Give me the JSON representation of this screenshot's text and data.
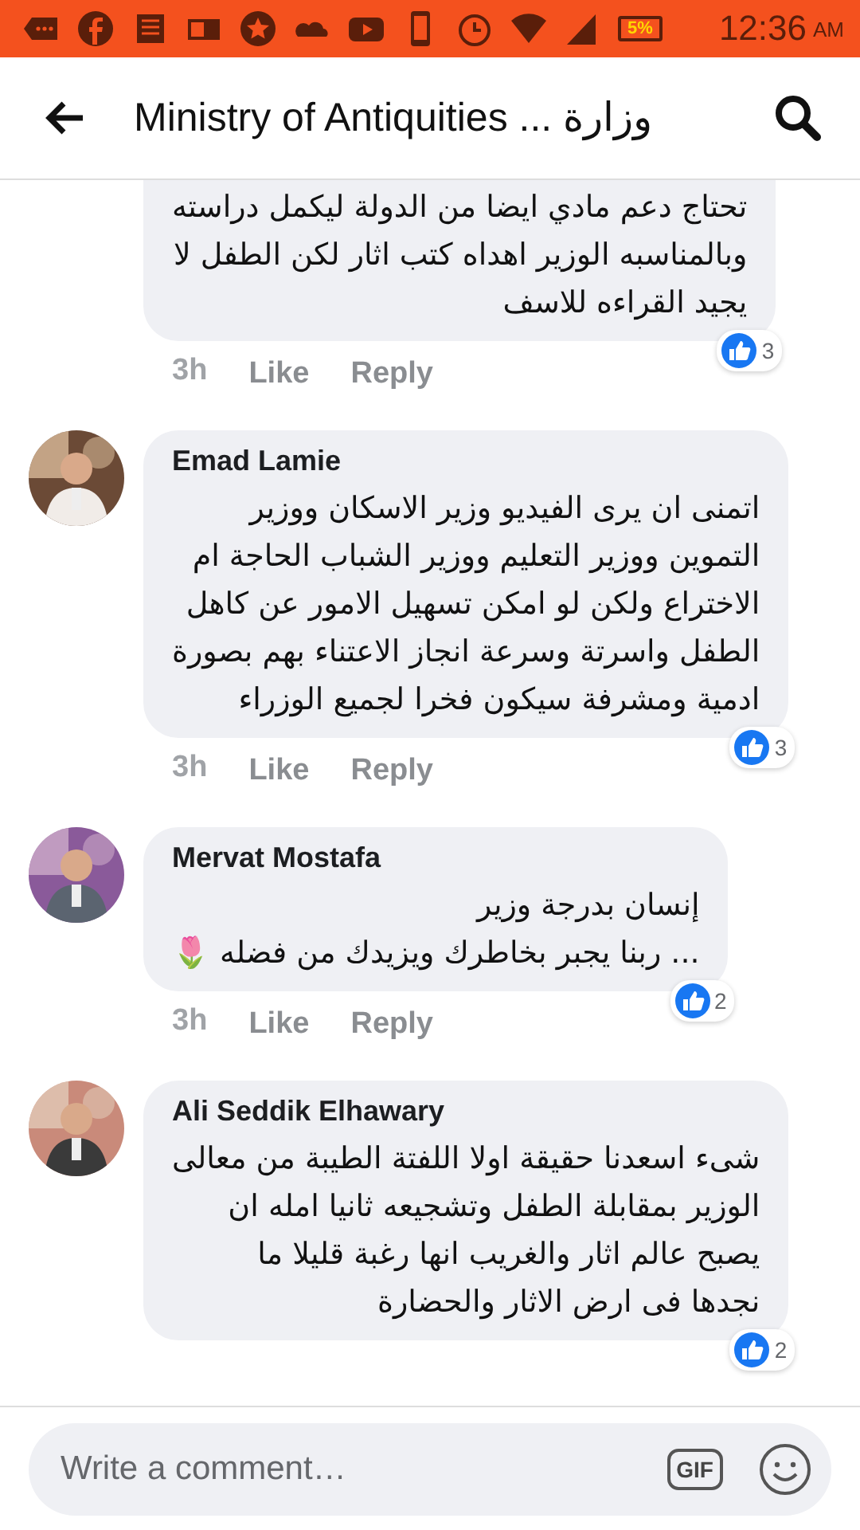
{
  "status_bar": {
    "battery": "5%",
    "time": "12:36",
    "meridiem": "AM"
  },
  "header": {
    "title": "Ministry of Antiquities ... وزارة"
  },
  "comments": [
    {
      "text": "تحتاج دعم مادي ايضا من الدولة ليكمل دراسته\nوبالمناسبه الوزير اهداه كتب اثار لكن الطفل لا\nيجيد القراءه للاسف",
      "time": "3h",
      "like": "Like",
      "reply": "Reply",
      "reactions": "3"
    },
    {
      "author": "Emad Lamie",
      "text": "اتمنى ان يرى الفيديو وزير الاسكان ووزير\nالتموين ووزير التعليم ووزير الشباب الحاجة ام\nالاختراع ولكن لو امكن تسهيل الامور عن كاهل\nالطفل واسرتة وسرعة انجاز الاعتناء بهم بصورة\nادمية ومشرفة سيكون فخرا لجميع الوزراء",
      "time": "3h",
      "like": "Like",
      "reply": "Reply",
      "reactions": "3"
    },
    {
      "author": "Mervat Mostafa",
      "text": "إنسان بدرجة وزير\n... ربنا يجبر بخاطرك ويزيدك من فضله 🌷",
      "time": "3h",
      "like": "Like",
      "reply": "Reply",
      "reactions": "2"
    },
    {
      "author": "Ali Seddik Elhawary",
      "text": "شىء اسعدنا حقيقة اولا اللفتة الطيبة من معالى\nالوزير بمقابلة الطفل وتشجيعه ثانيا امله ان\nيصبح عالم اثار والغريب انها رغبة قليلا ما\nنجدها فى ارض الاثار والحضارة",
      "reactions": "2"
    }
  ],
  "composer": {
    "placeholder": "Write a comment…",
    "gif": "GIF"
  }
}
